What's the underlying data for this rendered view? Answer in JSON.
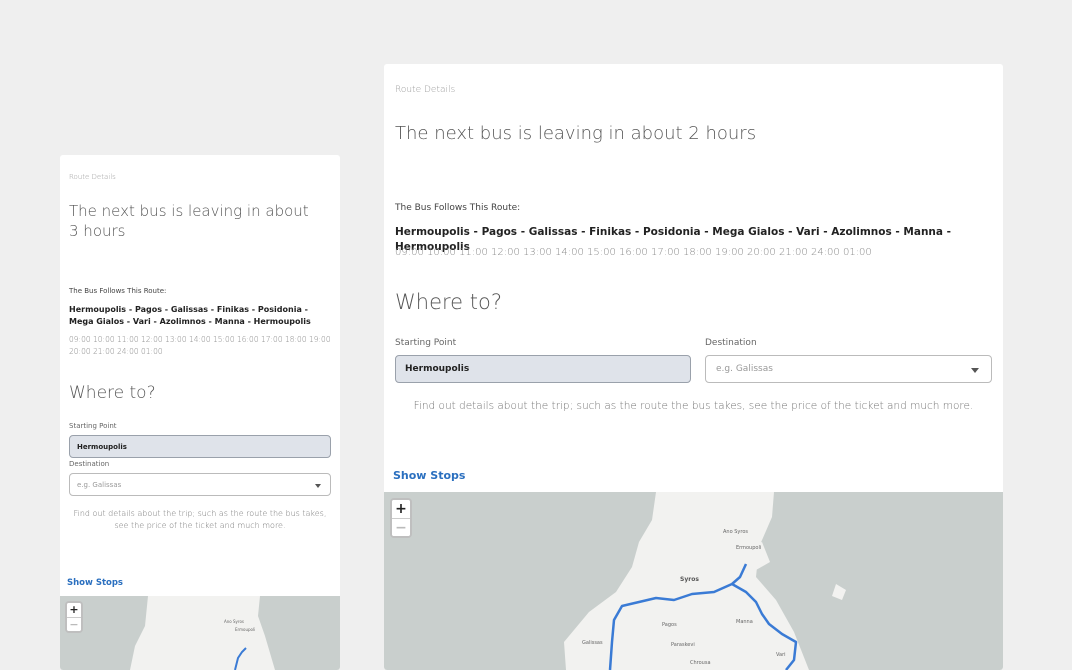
{
  "route_details_label": "Route Details",
  "small_card": {
    "next_bus": "The next bus is leaving in about 3 hours"
  },
  "large_card": {
    "next_bus": "The next bus is leaving in about 2 hours"
  },
  "route_label": "The Bus Follows This Route:",
  "route": "Hermoupolis - Pagos - Galissas - Finikas - Posidonia - Mega Gialos - Vari - Azolimnos - Manna - Hermoupolis",
  "times": "09:00 10:00 11:00 12:00 13:00 14:00 15:00 16:00 17:00 18:00 19:00 20:00 21:00 24:00 01:00",
  "where_to": "Where to?",
  "starting_point_label": "Starting Point",
  "starting_point_value": "Hermoupolis",
  "destination_label": "Destination",
  "destination_placeholder": "e.g. Galissas",
  "hint": "Find out details about the trip; such as the route the bus takes, see the price of the ticket and much more.",
  "show_stops": "Show Stops",
  "map": {
    "zoom_in": "+",
    "zoom_out": "−",
    "places": {
      "ano_syros": "Ano Syros",
      "ermoupoli": "Ermoupoli",
      "syros": "Syros",
      "manna": "Manna",
      "pagos": "Pagos",
      "paraskevi": "Paraskevi",
      "vari": "Vari",
      "chrousa": "Chrousa",
      "galissas": "Galissas"
    },
    "route_color": "#3a7bd5",
    "land_color": "#f2f2f0",
    "sea_color": "#c9cfcd"
  }
}
